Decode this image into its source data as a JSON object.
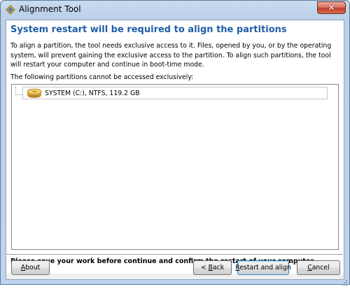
{
  "window": {
    "title": "Alignment Tool",
    "close_glyph": "✕"
  },
  "content": {
    "heading": "System restart will be required to align the partitions",
    "description": "To align a partition, the tool needs exclusive access to it. Files, opened by you, or by the operating system, will prevent gaining the exclusive access to the partition. To align such partitions, the tool will restart your computer and continue in boot-time mode.",
    "list_label": "The following partitions cannot be accessed exclusively:",
    "partitions": [
      {
        "label": "SYSTEM (C:), NTFS, 119.2 GB",
        "icon": "hard-disk-icon"
      }
    ],
    "warning": "Please save your work before continue and confirm the restart of your computer."
  },
  "buttons": {
    "about_prefix": "",
    "about_mnemonic": "A",
    "about_rest": "bout",
    "back_prefix": "< ",
    "back_mnemonic": "B",
    "back_rest": "ack",
    "restart_mnemonic": "R",
    "restart_rest": "estart and align",
    "cancel_mnemonic": "C",
    "cancel_rest": "ancel"
  },
  "colors": {
    "heading": "#1e5ea8",
    "window_frame": "#bcd1ea",
    "close_button": "#c2402a"
  }
}
